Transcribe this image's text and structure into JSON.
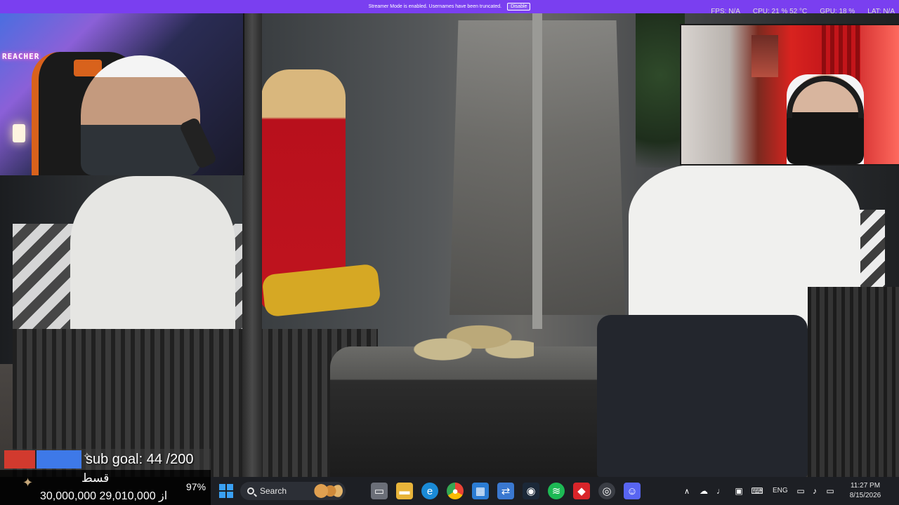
{
  "banner": {
    "message": "Streamer Mode is enabled. Usernames have been truncated.",
    "disable_label": "Disable",
    "stats": [
      "FPS: N/A",
      "CPU: 21 % 52 °C",
      "GPU: 18 %",
      "LAT: N/A"
    ]
  },
  "webcam_left": {
    "neon_sign": "REACHER"
  },
  "sub_goal": {
    "label": "sub goal: 44 /200"
  },
  "donation": {
    "title": "قسط",
    "percent": "97%",
    "amount": "30,000,000 از 29,010,000"
  },
  "taskbar": {
    "search_placeholder": "Search",
    "language": "ENG",
    "time": "11:27 PM",
    "date": "8/15/2026"
  },
  "colors": {
    "banner": "#7a3ff0",
    "taskbar": "#1d1f24",
    "accent": "#3aa0f3"
  }
}
